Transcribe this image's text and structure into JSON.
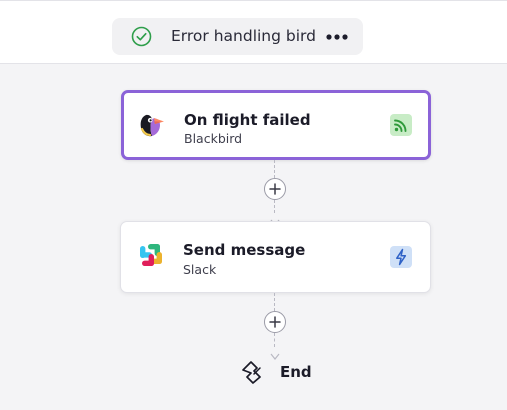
{
  "header": {
    "flow_name": "Error handling bird",
    "status_icon": "check-circle-icon",
    "menu_icon": "more-horizontal-icon"
  },
  "steps": [
    {
      "kind": "trigger",
      "title": "On flight failed",
      "app": "Blackbird",
      "logo_icon": "blackbird-logo-icon",
      "badge_icon": "event-feed-icon",
      "badge_color": "#c8ecc6"
    },
    {
      "kind": "action",
      "title": "Send message",
      "app": "Slack",
      "logo_icon": "slack-logo-icon",
      "badge_icon": "lightning-icon",
      "badge_color": "#cfe0f7"
    }
  ],
  "end": {
    "label": "End",
    "icon": "end-flag-icon"
  },
  "colors": {
    "selected_border": "#8b63d8",
    "success_check": "#2e9e4a",
    "canvas_background": "#f4f4f6"
  }
}
